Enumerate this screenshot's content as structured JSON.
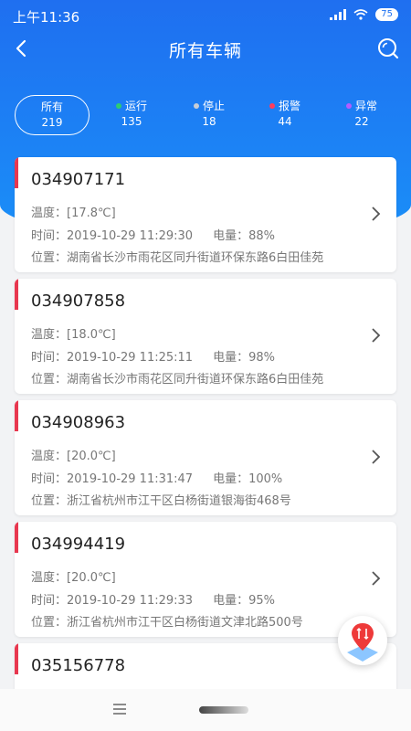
{
  "status_bar": {
    "time": "上午11:36",
    "battery": "75"
  },
  "nav": {
    "title": "所有车辆"
  },
  "filters": [
    {
      "label": "所有",
      "count": "219",
      "dot_color": null
    },
    {
      "label": "运行",
      "count": "135",
      "dot_color": "#2ecc71"
    },
    {
      "label": "停止",
      "count": "18",
      "dot_color": "#c7cdd6"
    },
    {
      "label": "报警",
      "count": "44",
      "dot_color": "#ff3b5c"
    },
    {
      "label": "异常",
      "count": "22",
      "dot_color": "#b45cff"
    }
  ],
  "vehicles": [
    {
      "id": "034907171",
      "temp": "温度：[17.8℃]",
      "time": "时间：2019-10-29 11:29:30",
      "power": "电量：88%",
      "location": "位置：湖南省长沙市雨花区同升街道环保东路6白田佳苑"
    },
    {
      "id": "034907858",
      "temp": "温度：[18.0℃]",
      "time": "时间：2019-10-29 11:25:11",
      "power": "电量：98%",
      "location": "位置：湖南省长沙市雨花区同升街道环保东路6白田佳苑"
    },
    {
      "id": "034908963",
      "temp": "温度：[20.0℃]",
      "time": "时间：2019-10-29 11:31:47",
      "power": "电量：100%",
      "location": "位置：浙江省杭州市江干区白杨街道银海街468号"
    },
    {
      "id": "034994419",
      "temp": "温度：[20.0℃]",
      "time": "时间：2019-10-29 11:29:33",
      "power": "电量：95%",
      "location": "位置：浙江省杭州市江干区白杨街道文津北路500号"
    },
    {
      "id": "035156778"
    }
  ],
  "colors": {
    "primary": "#1f6ff0",
    "alert_bar": "#e8374f"
  },
  "icons": {
    "back": "chevron-left-icon",
    "search": "search-icon",
    "map": "map-pin-icon",
    "menu": "menu-icon"
  }
}
